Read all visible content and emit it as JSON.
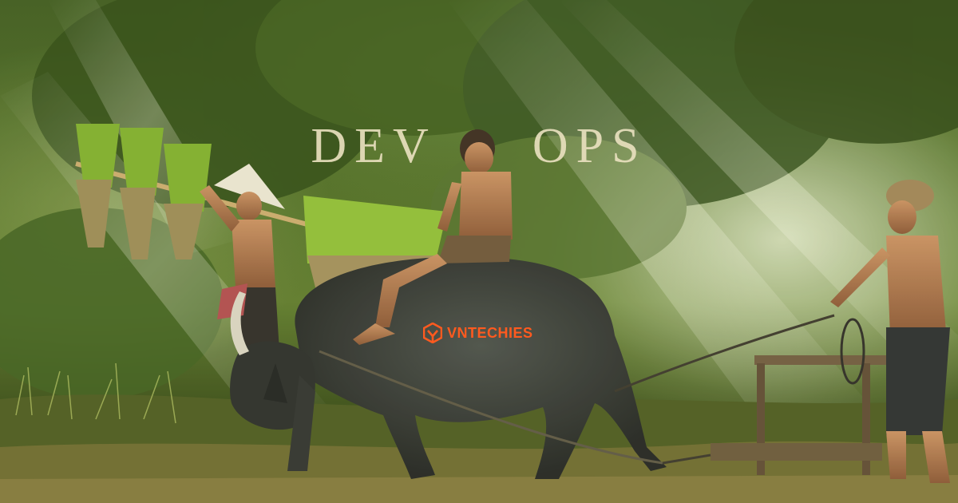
{
  "headline": {
    "part1": "DEV",
    "part2": "OPS"
  },
  "brand": {
    "name": "VNTECHIES",
    "color": "#ff5a1f",
    "icon": "vntechies-hexagon-logo"
  },
  "photo": {
    "subject": "rice-field-buffalo-farmers"
  }
}
